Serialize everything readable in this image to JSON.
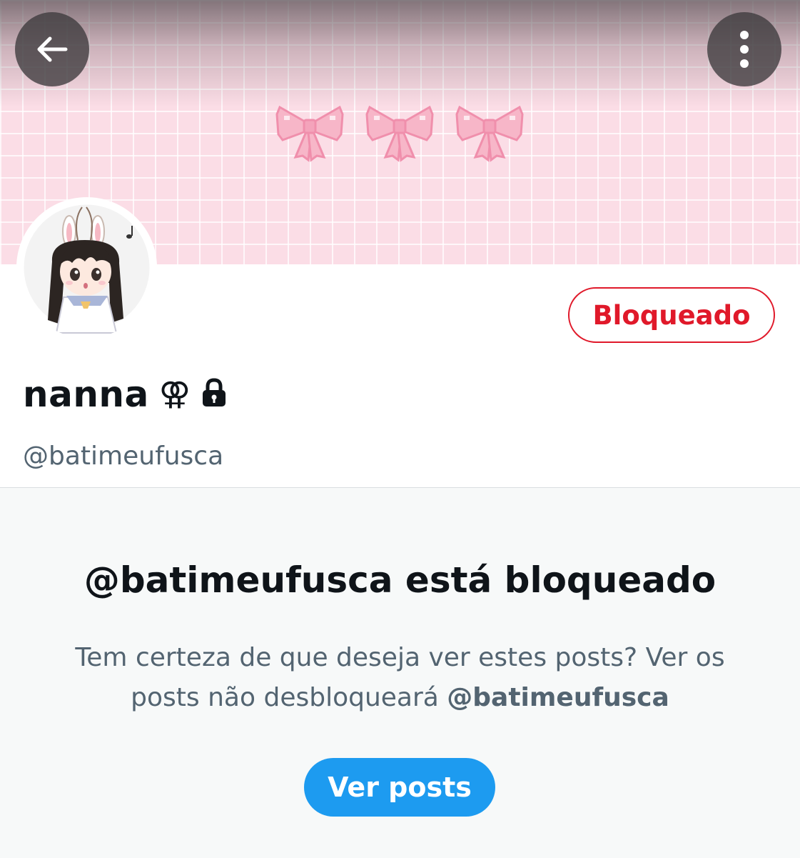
{
  "header": {
    "back_icon": "arrow-left-icon",
    "more_icon": "vertical-ellipsis-icon"
  },
  "banner": {
    "decoration": "pink-bow-icon",
    "bow_count": 3,
    "background_color": "#fbdde6"
  },
  "profile": {
    "display_name": "nanna",
    "gender_symbol": "⚢",
    "lock_icon": "lock-icon",
    "handle": "@batimeufusca",
    "blocked_button_label": "Bloqueado"
  },
  "blocked_notice": {
    "title": "@batimeufusca está bloqueado",
    "description_prefix": "Tem certeza de que deseja ver estes posts? Ver os posts não desbloqueará ",
    "description_handle": "@batimeufusca",
    "view_posts_label": "Ver posts"
  },
  "colors": {
    "danger": "#e0192a",
    "primary": "#1d9bf0",
    "text_primary": "#0f1419",
    "text_secondary": "#536471"
  }
}
